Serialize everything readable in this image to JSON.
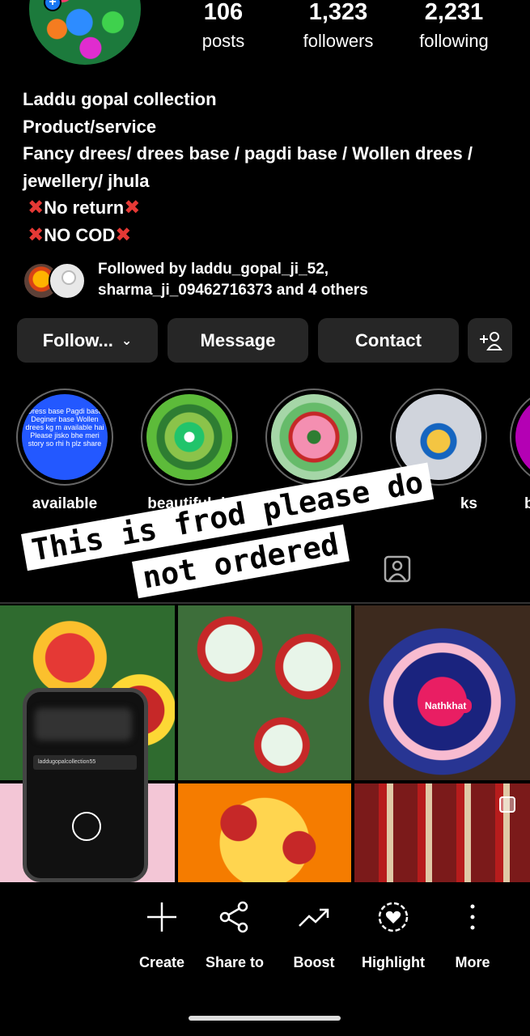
{
  "profile": {
    "stats": [
      {
        "value": "106",
        "label": "posts"
      },
      {
        "value": "1,323",
        "label": "followers"
      },
      {
        "value": "2,231",
        "label": "following"
      }
    ],
    "bio": {
      "name": "Laddu gopal collection",
      "category": "Product/service",
      "line1": "Fancy drees/ drees base / pagdi base / Wollen drees /",
      "line2": "jewellery/ jhula",
      "line3": "No return",
      "line4": "NO COD"
    },
    "followed_by": {
      "line1": "Followed by laddu_gopal_ji_52,",
      "line2": "sharma_ji_09462716373 and 4 others"
    }
  },
  "buttons": {
    "follow": "Follow...",
    "message": "Message",
    "contact": "Contact"
  },
  "highlights": [
    {
      "label": "available",
      "cover_text": "Dress base Pagdi base Deginer base Wollen drees kg m available hai Please jisko bhe meri story so rhi h plz share"
    },
    {
      "label": "beautiful dr"
    },
    {
      "label": ""
    },
    {
      "label": "ks"
    },
    {
      "label": "b"
    }
  ],
  "overlay": {
    "line1": "This is frod please do",
    "line2": "not ordered"
  },
  "grid": {
    "nathkhat_tag": "Nathkhat",
    "phone_username": "laddugopalcollection55"
  },
  "actions": [
    {
      "label": "Create",
      "icon": "plus-icon"
    },
    {
      "label": "Share to",
      "icon": "share-icon"
    },
    {
      "label": "Boost",
      "icon": "trend-up-icon"
    },
    {
      "label": "Highlight",
      "icon": "heart-circle-icon"
    },
    {
      "label": "More",
      "icon": "more-vertical-icon"
    }
  ]
}
